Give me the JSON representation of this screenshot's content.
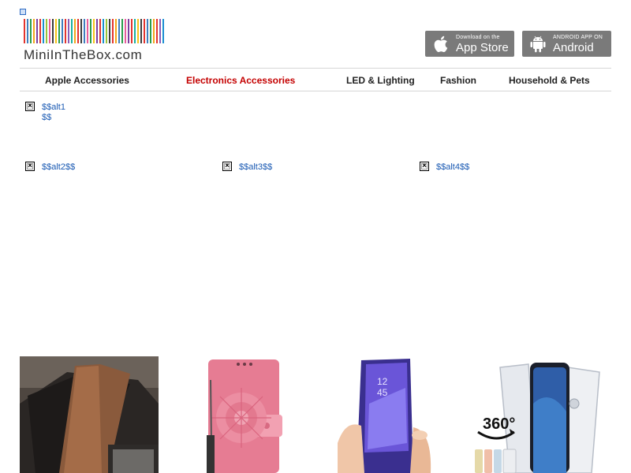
{
  "logo": {
    "text": "MiniInTheBox.com",
    "stripe_colors": [
      "#e3342f",
      "#3f7fbf",
      "#2a9d4b",
      "#f2a81d",
      "#7b3fa0",
      "#e3342f",
      "#1b8fd1",
      "#9ac43c",
      "#e85d9a",
      "#3c3c3c",
      "#f7c31a",
      "#2a9d4b",
      "#3f7fbf",
      "#e3342f",
      "#8a5cb8",
      "#1bb0a0",
      "#f2a81d",
      "#e3342f",
      "#3c3c3c",
      "#3f7fbf",
      "#e85d9a",
      "#2a9d4b",
      "#f7c31a",
      "#7b3fa0",
      "#e3342f",
      "#1b8fd1",
      "#9ac43c",
      "#3c3c3c",
      "#e3342f",
      "#f2a81d",
      "#3f7fbf",
      "#2a9d4b",
      "#e85d9a",
      "#7b3fa0",
      "#e3342f",
      "#1bb0a0",
      "#f7c31a",
      "#3c3c3c",
      "#e3342f",
      "#3f7fbf",
      "#2a9d4b",
      "#f2a81d",
      "#e3342f",
      "#8a5cb8",
      "#1b8fd1"
    ]
  },
  "app_store": {
    "small": "Download on the",
    "big": "App Store",
    "icon": "apple-icon"
  },
  "android": {
    "small": "ANDROID APP ON",
    "big": "Android",
    "icon": "android-icon"
  },
  "nav": {
    "items": [
      {
        "label": "Apple Accessories",
        "active": false
      },
      {
        "label": "Electronics Accessories",
        "active": true
      },
      {
        "label": "LED & Lighting",
        "active": false
      },
      {
        "label": "Fashion",
        "active": false
      },
      {
        "label": "Household & Pets",
        "active": false
      }
    ]
  },
  "broken_images": [
    {
      "alt": "$$alt1 $$",
      "icon": "broken-image-icon"
    },
    {
      "alt": "$$alt2$$",
      "icon": "broken-image-icon"
    },
    {
      "alt": "$$alt3$$",
      "icon": "broken-image-icon"
    },
    {
      "alt": "$$alt4$$",
      "icon": "broken-image-icon"
    }
  ],
  "colors": {
    "accent_red": "#c40000",
    "link_blue": "#1a5ab3",
    "button_gray": "#7a7a7a"
  }
}
